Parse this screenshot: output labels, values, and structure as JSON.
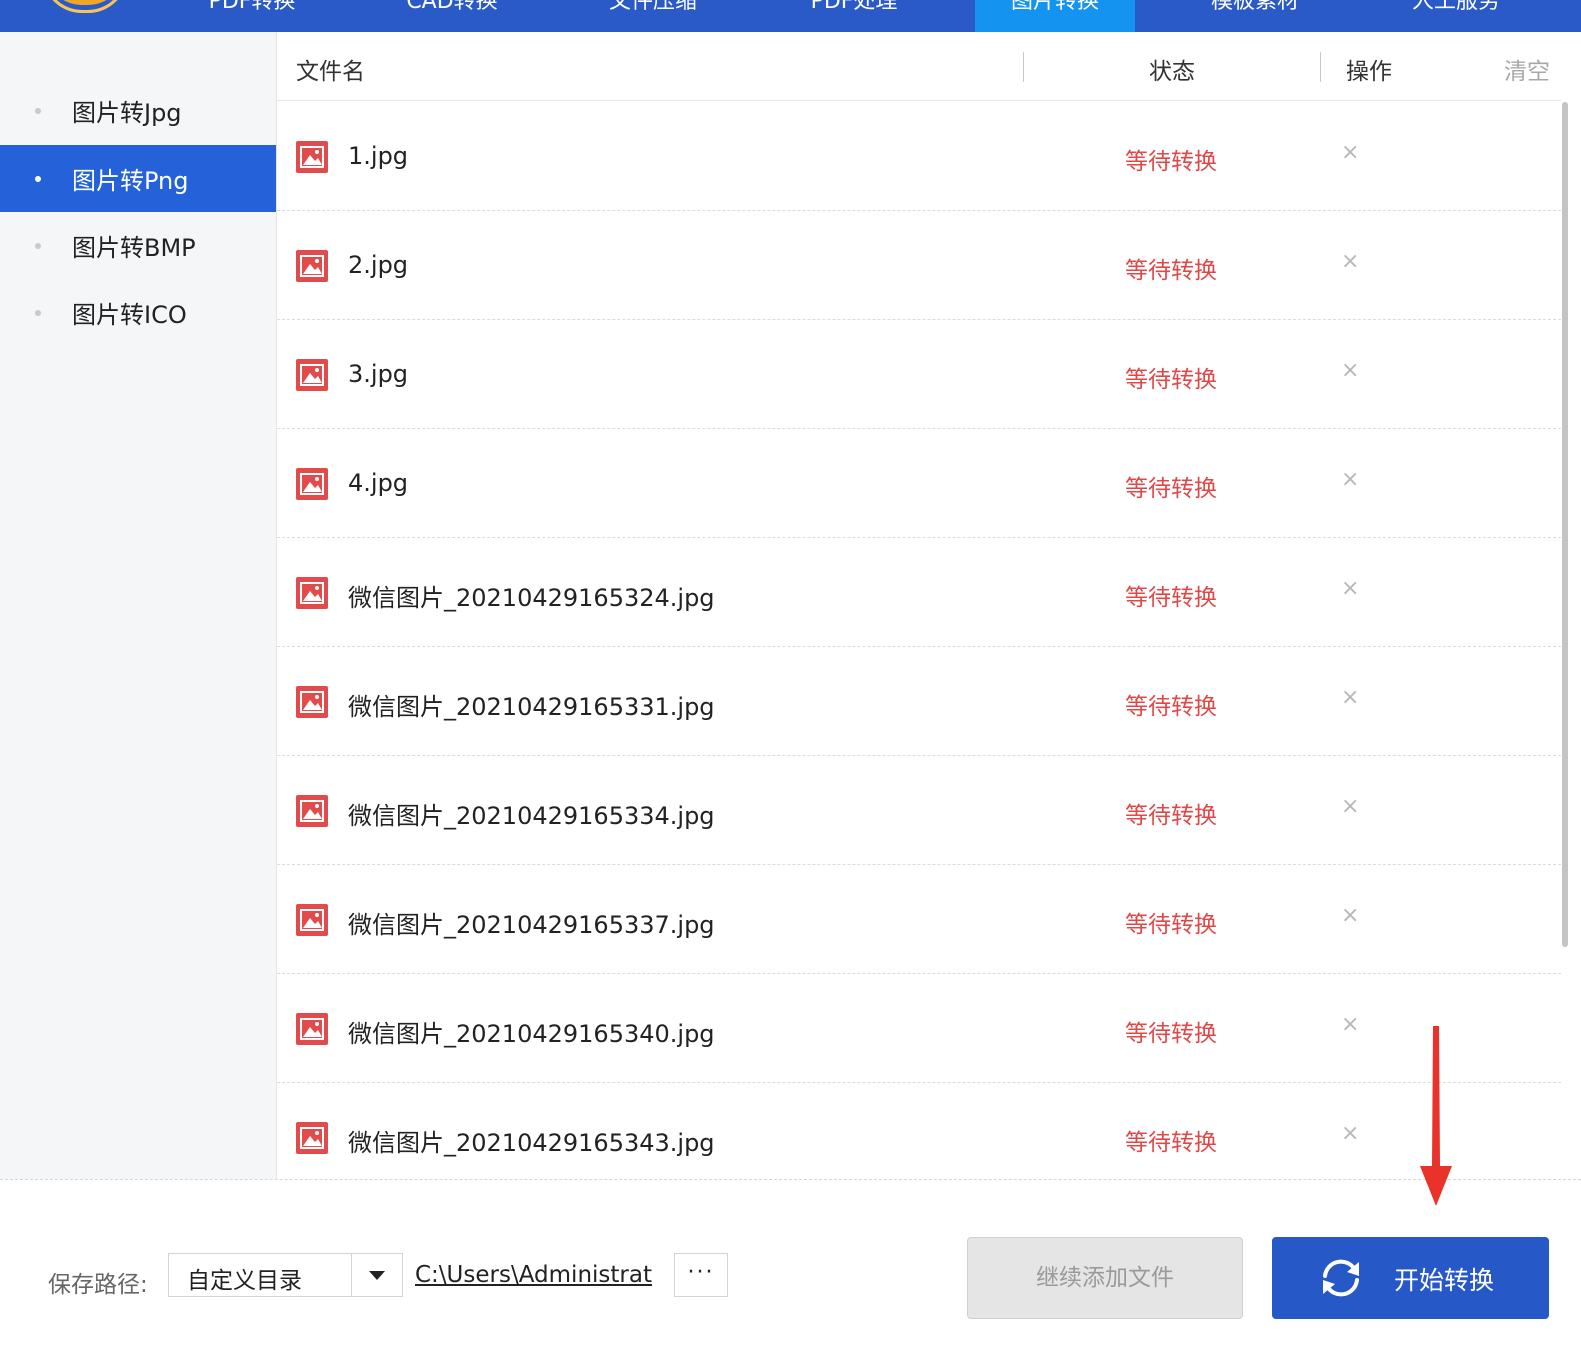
{
  "nav": {
    "tabs": [
      "PDF转换",
      "CAD转换",
      "文件压缩",
      "PDF处理",
      "图片转换",
      "模板素材",
      "人工服务"
    ],
    "active_index": 4
  },
  "sidebar": {
    "items": [
      "图片转Jpg",
      "图片转Png",
      "图片转BMP",
      "图片转ICO"
    ],
    "active_index": 1
  },
  "table": {
    "headers": {
      "filename": "文件名",
      "status": "状态",
      "action": "操作",
      "clear": "清空"
    },
    "rows": [
      {
        "name": "1.jpg",
        "status": "等待转换"
      },
      {
        "name": "2.jpg",
        "status": "等待转换"
      },
      {
        "name": "3.jpg",
        "status": "等待转换"
      },
      {
        "name": "4.jpg",
        "status": "等待转换"
      },
      {
        "name": "微信图片_20210429165324.jpg",
        "status": "等待转换"
      },
      {
        "name": "微信图片_20210429165331.jpg",
        "status": "等待转换"
      },
      {
        "name": "微信图片_20210429165334.jpg",
        "status": "等待转换"
      },
      {
        "name": "微信图片_20210429165337.jpg",
        "status": "等待转换"
      },
      {
        "name": "微信图片_20210429165340.jpg",
        "status": "等待转换"
      },
      {
        "name": "微信图片_20210429165343.jpg",
        "status": "等待转换"
      }
    ],
    "delete_symbol": "×"
  },
  "footer": {
    "save_label": "保存路径:",
    "dir_select": "自定义目录",
    "path": "C:\\Users\\Administrat",
    "browse": "···",
    "add_button": "继续添加文件",
    "start_button": "开始转换"
  },
  "colors": {
    "nav_bg": "#2a5ac8",
    "nav_active": "#1593f0",
    "sidebar_active": "#2561d8",
    "status_red": "#e04848",
    "start_button": "#2758c8",
    "annotation_arrow": "#e8322a"
  },
  "icons": {
    "file": "image-file-icon",
    "delete": "close-icon",
    "dropdown": "caret-down-icon",
    "start": "refresh-icon"
  }
}
